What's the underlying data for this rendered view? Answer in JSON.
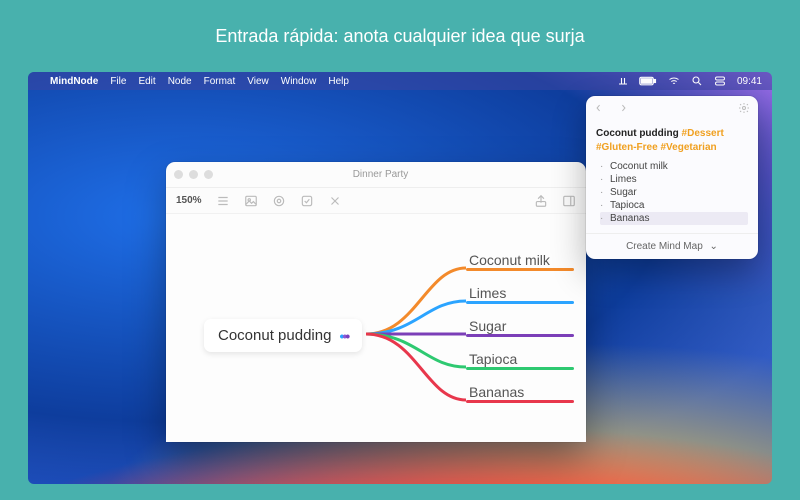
{
  "hero": {
    "headline": "Entrada rápida: anota cualquier idea que surja"
  },
  "menubar": {
    "app": "MindNode",
    "items": [
      "File",
      "Edit",
      "Node",
      "Format",
      "View",
      "Window",
      "Help"
    ],
    "clock": "09:41"
  },
  "doc": {
    "title": "Dinner Party",
    "zoom": "150%",
    "root": "Coconut pudding",
    "branches": [
      {
        "label": "Coconut milk",
        "color": "#f38a2b"
      },
      {
        "label": "Limes",
        "color": "#2ba4ff"
      },
      {
        "label": "Sugar",
        "color": "#7b3fb8"
      },
      {
        "label": "Tapioca",
        "color": "#2ec971"
      },
      {
        "label": "Bananas",
        "color": "#e8374c"
      }
    ]
  },
  "panel": {
    "title_text": "Coconut pudding",
    "tags": [
      "#Dessert",
      "#Gluten-Free",
      "#Vegetarian"
    ],
    "items": [
      "Coconut milk",
      "Limes",
      "Sugar",
      "Tapioca",
      "Bananas"
    ],
    "selected_index": 4,
    "footer": "Create Mind Map"
  }
}
